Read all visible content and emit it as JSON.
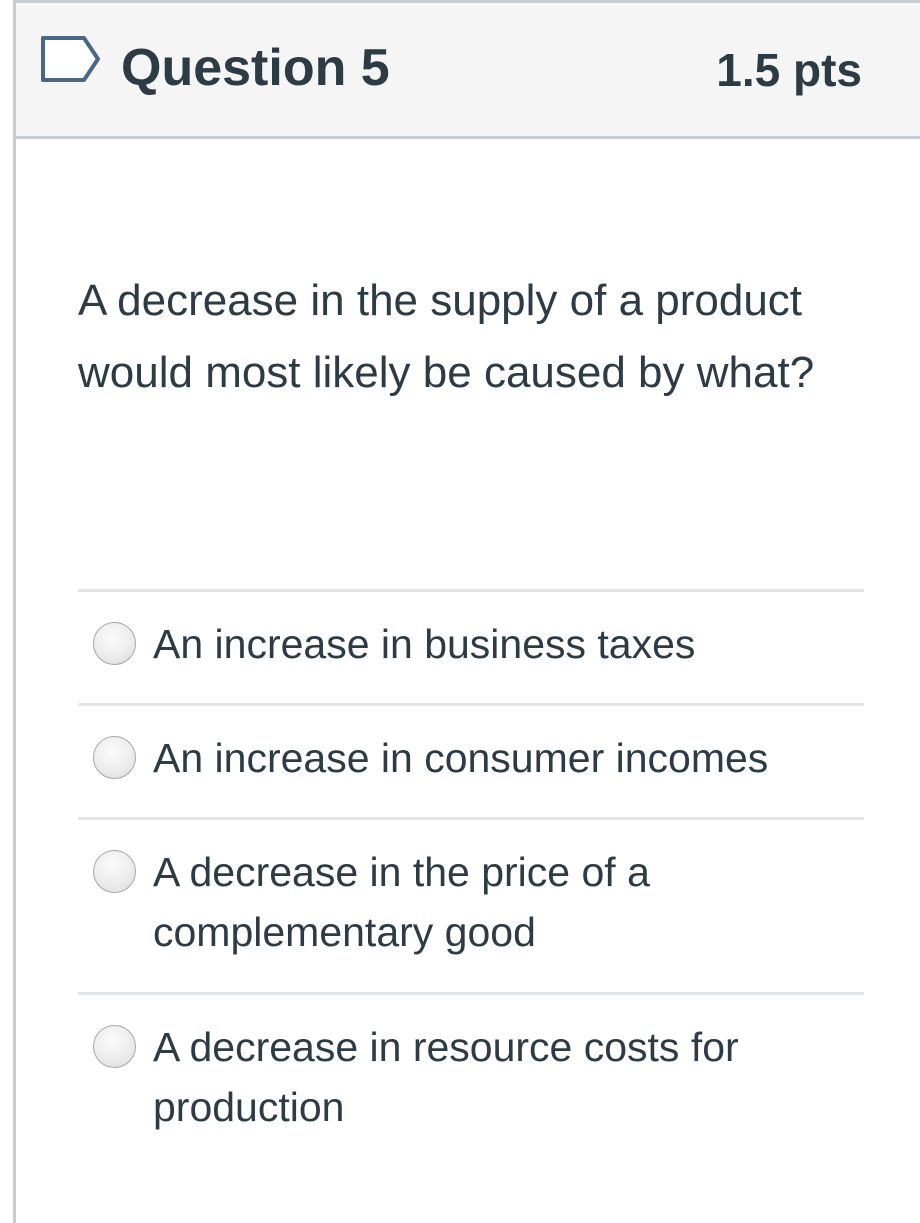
{
  "question": {
    "flag_icon": "bookmark-flag-icon",
    "title": "Question 5",
    "points": "1.5 pts",
    "text": "A decrease in the supply of a product would most likely be caused by what?"
  },
  "answers": [
    {
      "label": "An increase in business taxes",
      "selected": false
    },
    {
      "label": "An increase in consumer incomes",
      "selected": false
    },
    {
      "label": "A decrease in the price of a complementary good",
      "selected": false
    },
    {
      "label": "A decrease in resource costs for production",
      "selected": false
    }
  ],
  "colors": {
    "text": "#2d3b45",
    "header_bg": "#f5f5f5",
    "border": "#c7cdd1",
    "flag_outline": "#4a6785"
  }
}
